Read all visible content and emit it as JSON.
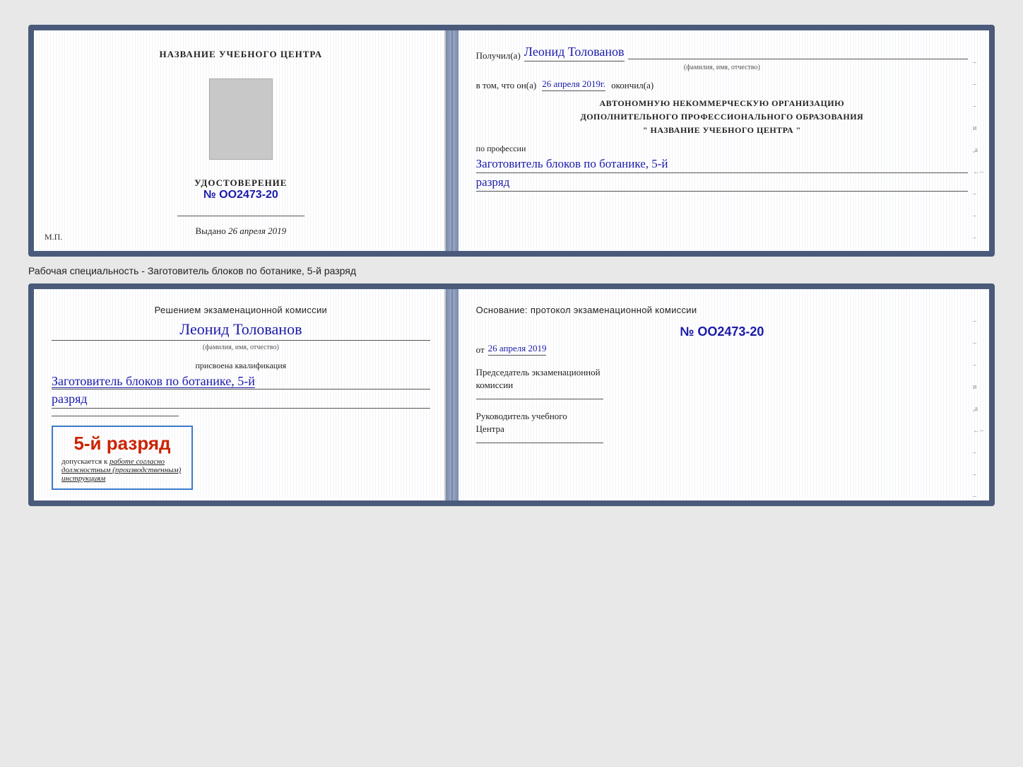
{
  "doc1": {
    "left": {
      "center_title": "НАЗВАНИЕ УЧЕБНОГО ЦЕНТРА",
      "udost_label": "УДОСТОВЕРЕНИЕ",
      "udost_number": "№ OO2473-20",
      "vydano_label": "Выдано",
      "vydano_date": "26 апреля 2019",
      "mp_label": "М.П."
    },
    "right": {
      "poluchil_label": "Получил(а)",
      "recipient_name": "Леонид Толованов",
      "fio_hint": "(фамилия, имя, отчество)",
      "vtom_label": "в том, что он(а)",
      "vtom_date": "26 апреля 2019г.",
      "okonchil_label": "окончил(а)",
      "org_line1": "АВТОНОМНУЮ НЕКОММЕРЧЕСКУЮ ОРГАНИЗАЦИЮ",
      "org_line2": "ДОПОЛНИТЕЛЬНОГО ПРОФЕССИОНАЛЬНОГО ОБРАЗОВАНИЯ",
      "org_line3": "\"    НАЗВАНИЕ УЧЕБНОГО ЦЕНТРА    \"",
      "po_professii_label": "по профессии",
      "profession": "Заготовитель блоков по ботанике, 5-й",
      "razryad": "разряд"
    }
  },
  "separator": {
    "text": "Рабочая специальность - Заготовитель блоков по ботанике, 5-й разряд"
  },
  "doc2": {
    "left": {
      "reshen_line1": "Решением экзаменационной комиссии",
      "recipient_name": "Леонид Толованов",
      "fio_hint": "(фамилия, имя, отчество)",
      "prisvoena_label": "присвоена квалификация",
      "profession": "Заготовитель блоков по ботанике, 5-й",
      "razryad": "разряд",
      "stamp_number": "5-й разряд",
      "dopuskaetsya_prefix": "допускается к",
      "dopuskaetsya_italic": "работе согласно должностным (производственным) инструкциям"
    },
    "right": {
      "osnovanie_label": "Основание: протокол экзаменационной комиссии",
      "protocol_number": "№ OO2473-20",
      "ot_label": "от",
      "ot_date": "26 апреля 2019",
      "predsed_line1": "Председатель экзаменационной",
      "predsed_line2": "комиссии",
      "ruk_line1": "Руководитель учебного",
      "ruk_line2": "Центра"
    }
  }
}
